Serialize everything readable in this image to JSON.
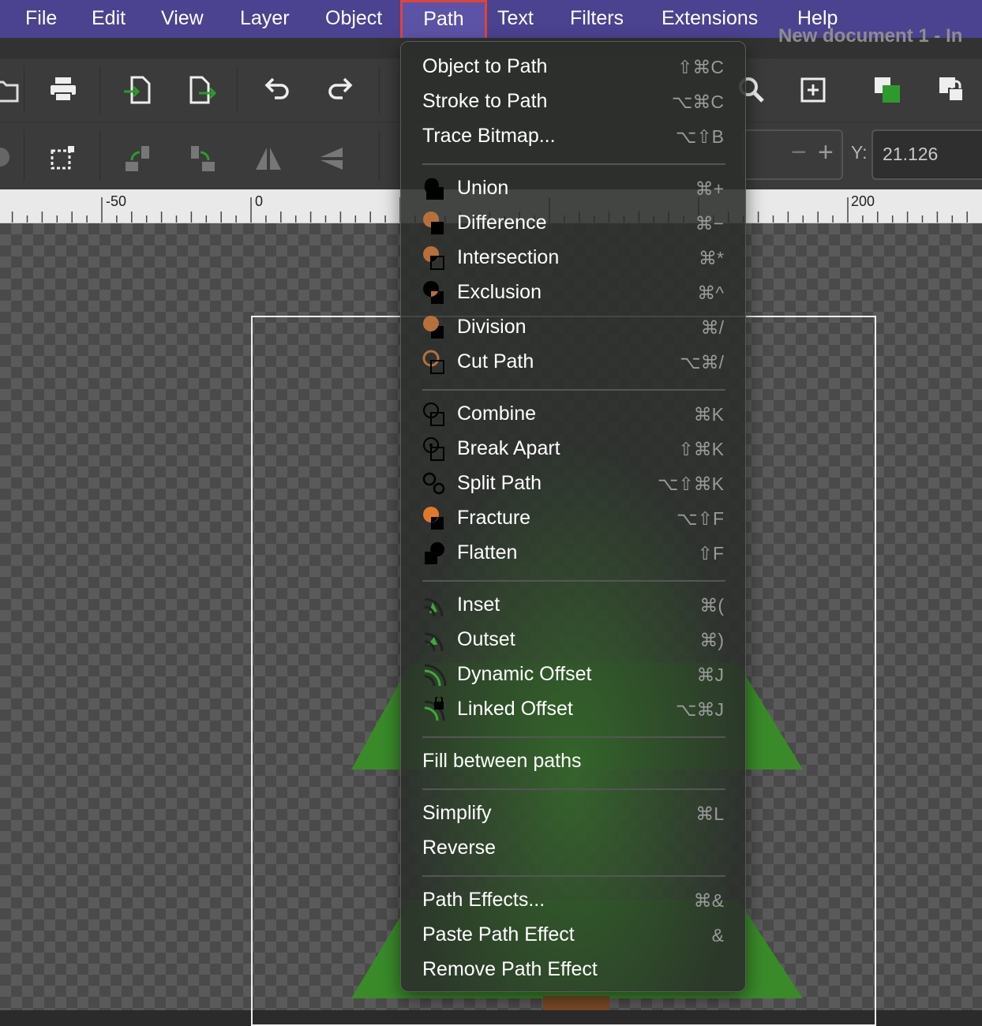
{
  "menubar": {
    "items": [
      "File",
      "Edit",
      "View",
      "Layer",
      "Object",
      "Path",
      "Text",
      "Filters",
      "Extensions",
      "Help"
    ],
    "active": "Path"
  },
  "window": {
    "title_fragment": "New document 1 - In"
  },
  "toolbar": {
    "y_label": "Y:",
    "y_value": "21.126"
  },
  "ruler": {
    "labels": [
      "-50",
      "0",
      "200"
    ]
  },
  "path_menu": {
    "groups": [
      [
        {
          "label": "Object to Path",
          "shortcut": "⇧⌘C",
          "icon": ""
        },
        {
          "label": "Stroke to Path",
          "shortcut": "⌥⌘C",
          "icon": ""
        },
        {
          "label": "Trace Bitmap...",
          "shortcut": "⌥⇧B",
          "icon": ""
        }
      ],
      [
        {
          "label": "Union",
          "shortcut": "⌘+",
          "icon": "union-icon"
        },
        {
          "label": "Difference",
          "shortcut": "⌘−",
          "icon": "difference-icon"
        },
        {
          "label": "Intersection",
          "shortcut": "⌘*",
          "icon": "intersection-icon"
        },
        {
          "label": "Exclusion",
          "shortcut": "⌘^",
          "icon": "exclusion-icon"
        },
        {
          "label": "Division",
          "shortcut": "⌘/",
          "icon": "division-icon"
        },
        {
          "label": "Cut Path",
          "shortcut": "⌥⌘/",
          "icon": "cut-path-icon"
        }
      ],
      [
        {
          "label": "Combine",
          "shortcut": "⌘K",
          "icon": "combine-icon"
        },
        {
          "label": "Break Apart",
          "shortcut": "⇧⌘K",
          "icon": "break-apart-icon"
        },
        {
          "label": "Split Path",
          "shortcut": "⌥⇧⌘K",
          "icon": "split-path-icon"
        },
        {
          "label": "Fracture",
          "shortcut": "⌥⇧F",
          "icon": "fracture-icon"
        },
        {
          "label": "Flatten",
          "shortcut": "⇧F",
          "icon": "flatten-icon"
        }
      ],
      [
        {
          "label": "Inset",
          "shortcut": "⌘(",
          "icon": "inset-icon"
        },
        {
          "label": "Outset",
          "shortcut": "⌘)",
          "icon": "outset-icon"
        },
        {
          "label": "Dynamic Offset",
          "shortcut": "⌘J",
          "icon": "dynamic-offset-icon"
        },
        {
          "label": "Linked Offset",
          "shortcut": "⌥⌘J",
          "icon": "linked-offset-icon"
        }
      ],
      [
        {
          "label": "Fill between paths",
          "shortcut": "",
          "icon": ""
        }
      ],
      [
        {
          "label": "Simplify",
          "shortcut": "⌘L",
          "icon": ""
        },
        {
          "label": "Reverse",
          "shortcut": "",
          "icon": ""
        }
      ],
      [
        {
          "label": "Path Effects...",
          "shortcut": "⌘&",
          "icon": ""
        },
        {
          "label": "Paste Path Effect",
          "shortcut": "&",
          "icon": ""
        },
        {
          "label": "Remove Path Effect",
          "shortcut": "",
          "icon": ""
        }
      ]
    ]
  },
  "colors": {
    "menubar": "#4b4290",
    "highlight_border": "#e0433a",
    "tree_green": "#3a8a2a",
    "icon_orange": "#b5703d"
  }
}
